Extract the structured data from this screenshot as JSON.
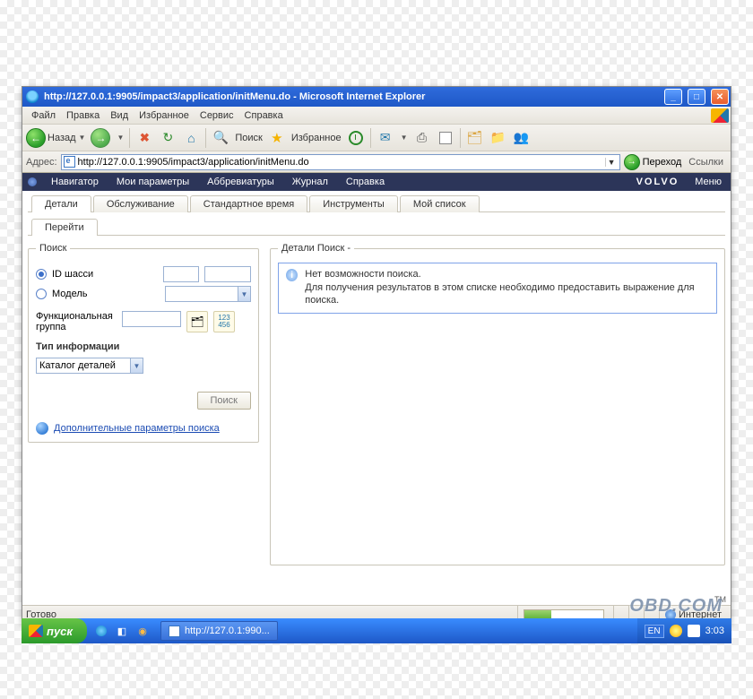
{
  "titlebar": {
    "text": "http://127.0.0.1:9905/impact3/application/initMenu.do - Microsoft Internet Explorer"
  },
  "menubar": {
    "items": [
      "Файл",
      "Правка",
      "Вид",
      "Избранное",
      "Сервис",
      "Справка"
    ]
  },
  "toolbar": {
    "back_label": "Назад",
    "search_label": "Поиск",
    "favorites_label": "Избранное"
  },
  "addressbar": {
    "label": "Адрес:",
    "url": "http://127.0.0.1:9905/impact3/application/initMenu.do",
    "go_label": "Переход",
    "links_label": "Ссылки"
  },
  "appnav": {
    "items": [
      "Навигатор",
      "Мои параметры",
      "Аббревиатуры",
      "Журнал",
      "Справка"
    ],
    "brand": "VOLVO",
    "menu_label": "Меню"
  },
  "tabs_main": [
    "Детали",
    "Обслуживание",
    "Стандартное время",
    "Инструменты",
    "Мой список"
  ],
  "tabs_main_active": 0,
  "tabs_sub": [
    "Перейти"
  ],
  "search": {
    "legend": "Поиск",
    "radio_chassis": "ID шасси",
    "radio_model": "Модель",
    "func_group_label": "Функциональная группа",
    "info_type_label": "Тип информации",
    "info_type_value": "Каталог деталей",
    "search_btn": "Поиск",
    "adv_link": "Дополнительные параметры поиска"
  },
  "details": {
    "legend": "Детали Поиск -",
    "msg_title": "Нет возможности поиска.",
    "msg_body": "Для получения результатов в этом списке необходимо предоставить выражение для поиска."
  },
  "statusbar": {
    "done": "Готово",
    "zone": "Интернет"
  },
  "taskbar": {
    "start": "пуск",
    "task": "http://127.0.1:990...",
    "lang": "EN",
    "time": "3:03"
  },
  "watermark": "OBD.COM",
  "tm": "TM"
}
